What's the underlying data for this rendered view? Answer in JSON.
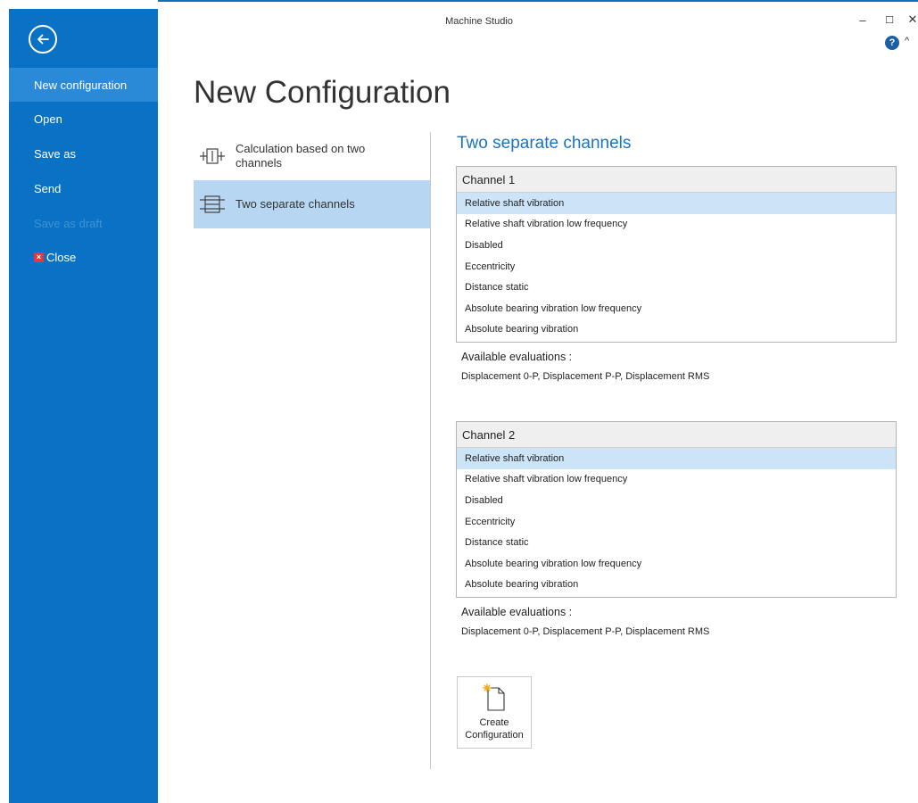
{
  "window": {
    "title": "Machine Studio",
    "minimize_glyph": "–",
    "maximize_glyph": "☐",
    "close_glyph": "✕",
    "help_glyph": "?",
    "collapse_glyph": "^"
  },
  "sidebar": {
    "back_icon": "back-arrow-icon",
    "items": [
      {
        "label": "New configuration",
        "state": "active"
      },
      {
        "label": "Open",
        "state": "normal"
      },
      {
        "label": "Save as",
        "state": "normal"
      },
      {
        "label": "Send",
        "state": "normal"
      },
      {
        "label": "Save as draft",
        "state": "disabled"
      },
      {
        "label": "Close",
        "state": "normal",
        "icon": "close-x-icon"
      }
    ],
    "colors": {
      "background": "#0a72c5",
      "active": "#2b8ad8"
    }
  },
  "page": {
    "title": "New Configuration"
  },
  "options": [
    {
      "label": "Calculation based on two channels",
      "icon": "calculation-channels-icon",
      "selected": false
    },
    {
      "label": "Two separate channels",
      "icon": "separate-channels-icon",
      "selected": true
    }
  ],
  "detail": {
    "title": "Two separate channels",
    "channels": [
      {
        "header": "Channel 1",
        "items": [
          "Relative shaft vibration",
          "Relative shaft vibration low frequency",
          "Disabled",
          "Eccentricity",
          "Distance static",
          "Absolute bearing vibration low frequency",
          "Absolute bearing vibration"
        ],
        "selected_index": 0,
        "evaluations_label": "Available evaluations :",
        "evaluations": "Displacement 0-P, Displacement P-P, Displacement RMS"
      },
      {
        "header": "Channel 2",
        "items": [
          "Relative shaft vibration",
          "Relative shaft vibration low frequency",
          "Disabled",
          "Eccentricity",
          "Distance static",
          "Absolute bearing vibration low frequency",
          "Absolute bearing vibration"
        ],
        "selected_index": 0,
        "evaluations_label": "Available evaluations :",
        "evaluations": "Displacement 0-P, Displacement P-P, Displacement RMS"
      }
    ],
    "create_button": {
      "line1": "Create",
      "line2": "Configuration",
      "icon": "new-document-icon"
    }
  }
}
